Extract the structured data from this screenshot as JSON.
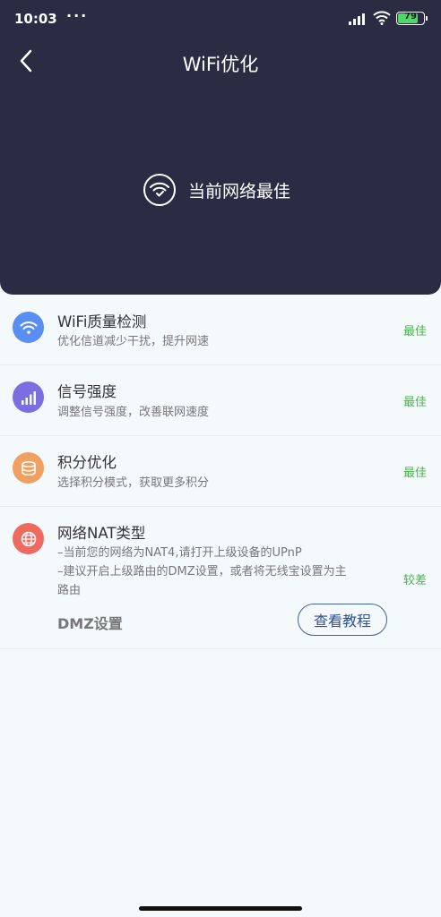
{
  "status_bar": {
    "time": "10:03",
    "dots": "···",
    "battery": "79",
    "battery_level": 0.79
  },
  "header": {
    "title": "WiFi优化",
    "status_text": "当前网络最佳"
  },
  "items": [
    {
      "icon": "wifi-icon",
      "title": "WiFi质量检测",
      "desc": "优化信道减少干扰，提升网速",
      "status": "最佳",
      "icon_color": "#5b8ef2"
    },
    {
      "icon": "signal-bars-icon",
      "title": "信号强度",
      "desc": "调整信号强度，改善联网速度",
      "status": "最佳",
      "icon_color": "#7a6fe0"
    },
    {
      "icon": "coins-icon",
      "title": "积分优化",
      "desc": "选择积分模式，获取更多积分",
      "status": "最佳",
      "icon_color": "#f0a060"
    },
    {
      "icon": "globe-icon",
      "title": "网络NAT类型",
      "desc_lines": [
        "–当前您的网络为NAT4,请打开上级设备的UPnP",
        "–建议开启上级路由的DMZ设置，或者将无线宝设置为主",
        "路由"
      ],
      "status": "较差",
      "icon_color": "#ee6a60",
      "dmz_label": "DMZ设置",
      "tutorial_button": "查看教程"
    }
  ],
  "colors": {
    "header_bg": "#2b2c44",
    "good_status": "#48b34a",
    "button_border": "#3f5f9e"
  }
}
